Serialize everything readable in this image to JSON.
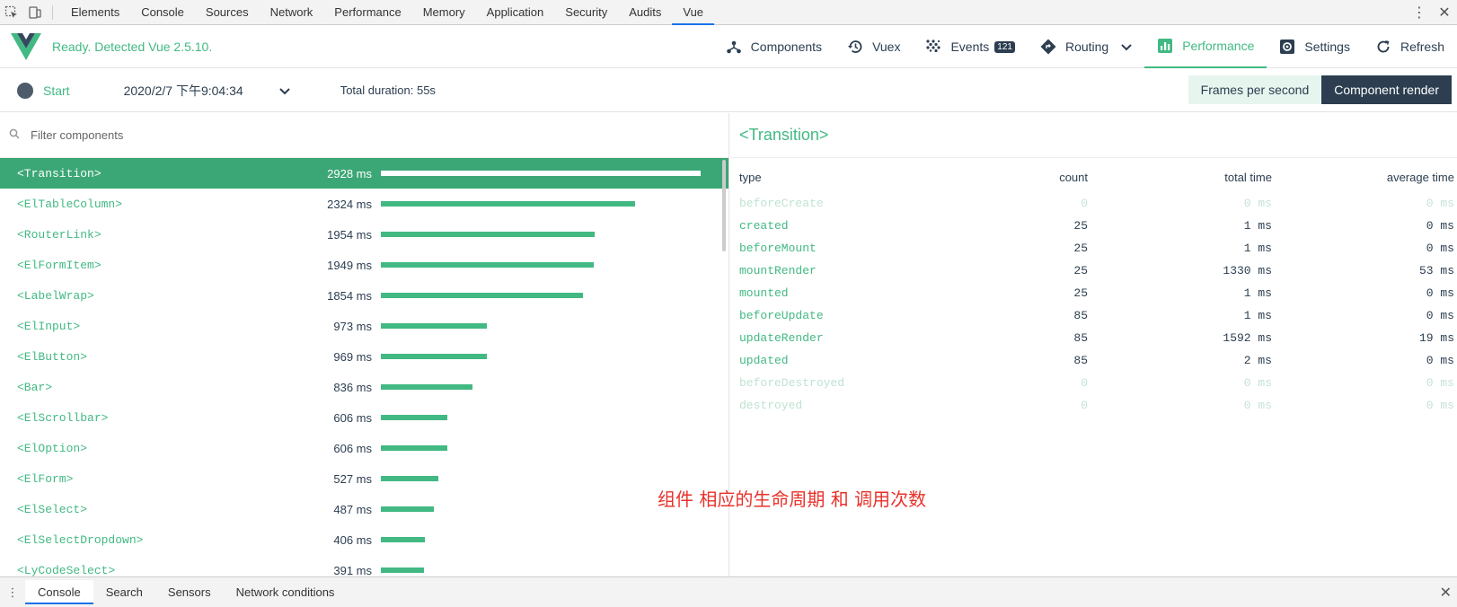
{
  "devtools": {
    "tabs": [
      "Elements",
      "Console",
      "Sources",
      "Network",
      "Performance",
      "Memory",
      "Application",
      "Security",
      "Audits",
      "Vue"
    ],
    "active_tab": "Vue"
  },
  "header": {
    "status": "Ready. Detected Vue 2.5.10.",
    "nav": [
      {
        "label": "Components",
        "icon": "components-icon"
      },
      {
        "label": "Vuex",
        "icon": "history-icon"
      },
      {
        "label": "Events",
        "icon": "events-icon",
        "badge": "121"
      },
      {
        "label": "Routing",
        "icon": "routing-icon"
      },
      {
        "label": "Performance",
        "icon": "performance-icon",
        "active": true
      },
      {
        "label": "Settings",
        "icon": "settings-icon"
      },
      {
        "label": "Refresh",
        "icon": "refresh-icon"
      }
    ]
  },
  "toolbar": {
    "start_label": "Start",
    "date": "2020/2/7 下午9:04:34",
    "duration": "Total duration: 55s",
    "btn_fps": "Frames per second",
    "btn_render": "Component render"
  },
  "filter": {
    "placeholder": "Filter components"
  },
  "components": [
    {
      "name": "<Transition>",
      "ms": "2928 ms",
      "value": 2928,
      "selected": true
    },
    {
      "name": "<ElTableColumn>",
      "ms": "2324 ms",
      "value": 2324
    },
    {
      "name": "<RouterLink>",
      "ms": "1954 ms",
      "value": 1954
    },
    {
      "name": "<ElFormItem>",
      "ms": "1949 ms",
      "value": 1949
    },
    {
      "name": "<LabelWrap>",
      "ms": "1854 ms",
      "value": 1854
    },
    {
      "name": "<ElInput>",
      "ms": "973 ms",
      "value": 973
    },
    {
      "name": "<ElButton>",
      "ms": "969 ms",
      "value": 969
    },
    {
      "name": "<Bar>",
      "ms": "836 ms",
      "value": 836
    },
    {
      "name": "<ElScrollbar>",
      "ms": "606 ms",
      "value": 606
    },
    {
      "name": "<ElOption>",
      "ms": "606 ms",
      "value": 606
    },
    {
      "name": "<ElForm>",
      "ms": "527 ms",
      "value": 527
    },
    {
      "name": "<ElSelect>",
      "ms": "487 ms",
      "value": 487
    },
    {
      "name": "<ElSelectDropdown>",
      "ms": "406 ms",
      "value": 406
    },
    {
      "name": "<LyCodeSelect>",
      "ms": "391 ms",
      "value": 391
    }
  ],
  "detail": {
    "title": "<Transition>",
    "headers": [
      "type",
      "count",
      "total time",
      "average time"
    ],
    "rows": [
      {
        "type": "beforeCreate",
        "count": "0",
        "total": "0 ms",
        "avg": "0 ms",
        "faded": true
      },
      {
        "type": "created",
        "count": "25",
        "total": "1 ms",
        "avg": "0 ms"
      },
      {
        "type": "beforeMount",
        "count": "25",
        "total": "1 ms",
        "avg": "0 ms"
      },
      {
        "type": "mountRender",
        "count": "25",
        "total": "1330 ms",
        "avg": "53 ms"
      },
      {
        "type": "mounted",
        "count": "25",
        "total": "1 ms",
        "avg": "0 ms"
      },
      {
        "type": "beforeUpdate",
        "count": "85",
        "total": "1 ms",
        "avg": "0 ms"
      },
      {
        "type": "updateRender",
        "count": "85",
        "total": "1592 ms",
        "avg": "19 ms"
      },
      {
        "type": "updated",
        "count": "85",
        "total": "2 ms",
        "avg": "0 ms"
      },
      {
        "type": "beforeDestroyed",
        "count": "0",
        "total": "0 ms",
        "avg": "0 ms",
        "faded": true
      },
      {
        "type": "destroyed",
        "count": "0",
        "total": "0 ms",
        "avg": "0 ms",
        "faded": true
      }
    ]
  },
  "annotation": "组件 相应的生命周期 和 调用次数",
  "drawer": {
    "tabs": [
      "Console",
      "Search",
      "Sensors",
      "Network conditions"
    ],
    "active": "Console"
  },
  "colors": {
    "accent": "#42b983",
    "dark": "#2c3e50",
    "selected_row": "#3ba776"
  }
}
